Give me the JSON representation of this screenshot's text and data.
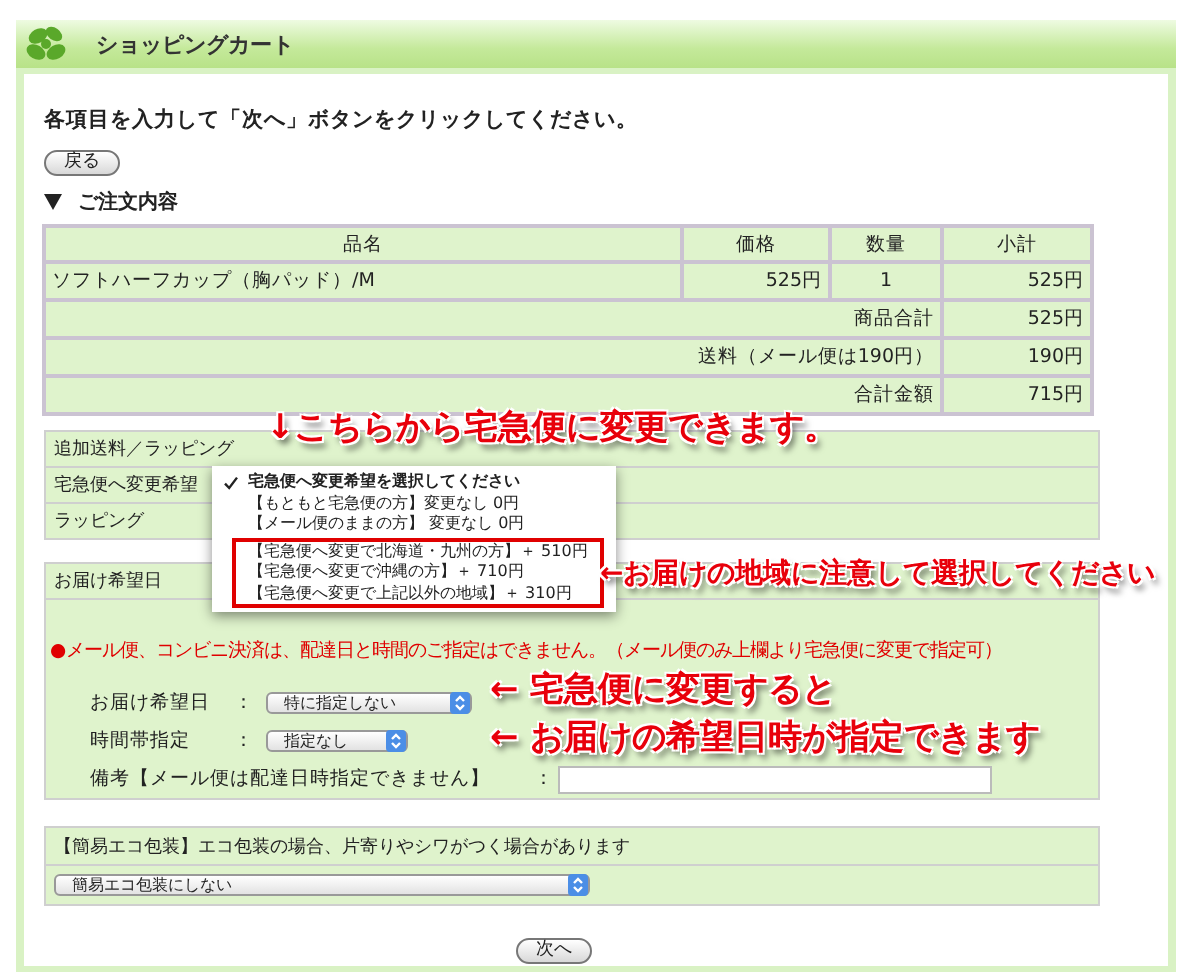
{
  "header": {
    "title": "ショッピングカート"
  },
  "instruction": "各項目を入力して「次へ」ボタンをクリックしてください。",
  "back_button": "戻る",
  "order_section": {
    "title": "ご注文内容",
    "expanded": true
  },
  "table": {
    "columns": [
      "品名",
      "価格",
      "数量",
      "小計"
    ],
    "rows": [
      {
        "cells": [
          "ソフトハーフカップ（胸パッド）/M",
          "525円",
          "1",
          "525円"
        ]
      }
    ],
    "summary": [
      {
        "label": "商品合計",
        "value": "525円"
      },
      {
        "label": "送料（メール便は190円）",
        "value": "190円"
      },
      {
        "label": "合計金額",
        "value": "715円"
      }
    ]
  },
  "options": {
    "rows": [
      {
        "label": "追加送料／ラッピング"
      },
      {
        "label": "宅急便へ変更希望"
      },
      {
        "label": "ラッピング"
      }
    ]
  },
  "shipping_menu": {
    "items": [
      {
        "label": "宅急便へ変更希望を選択してください",
        "selected": true,
        "highlighted": false
      },
      {
        "label": "【もともと宅急便の方】変更なし 0円",
        "selected": false,
        "highlighted": false
      },
      {
        "label": "【メール便のままの方】 変更なし 0円",
        "selected": false,
        "highlighted": false
      },
      {
        "label": "【宅急便へ変更で北海道・九州の方】＋ 510円",
        "selected": false,
        "highlighted": true
      },
      {
        "label": "【宅急便へ変更で沖縄の方】＋ 710円",
        "selected": false,
        "highlighted": true
      },
      {
        "label": "【宅急便へ変更で上記以外の地域】＋ 310円",
        "selected": false,
        "highlighted": true
      }
    ]
  },
  "delivery": {
    "title": "お届け希望日",
    "note": "●メール便、コンビニ決済は、配達日と時間のご指定はできません。（メール便のみ上欄より宅急便に変更で指定可）",
    "fields": [
      {
        "label": "お届け希望日",
        "separator": "：",
        "kind": "select",
        "value": "特に指定しない"
      },
      {
        "label": "時間帯指定",
        "separator": "：",
        "kind": "select",
        "value": "指定なし"
      },
      {
        "label": "備考【メール便は配達日時指定できません】",
        "separator": "：",
        "kind": "text"
      }
    ]
  },
  "eco": {
    "title": "【簡易エコ包装】エコ包装の場合、片寄りやシワがつく場合があります",
    "select": "簡易エコ包装にしない"
  },
  "next_button": "次へ",
  "annotations": [
    {
      "text": "↓こちらから宅急便に変更できます。"
    },
    {
      "text": "←お届けの地域に注意して選択してください"
    },
    {
      "text": "← 宅急便に変更すると"
    },
    {
      "text": "← お届けの希望日時が指定できます"
    }
  ]
}
